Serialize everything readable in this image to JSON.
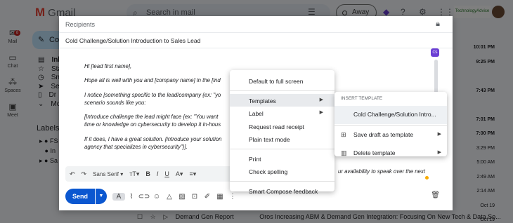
{
  "app": {
    "name": "Gmail",
    "search_placeholder": "Search in mail",
    "status": "Away",
    "brand_text": "TechnologyAdvice"
  },
  "rail": [
    {
      "icon": "mail-icon",
      "label": "Mail",
      "badge": "8"
    },
    {
      "icon": "chat-icon",
      "label": "Chat"
    },
    {
      "icon": "spaces-icon",
      "label": "Spaces"
    },
    {
      "icon": "meet-icon",
      "label": "Meet"
    }
  ],
  "sidebar": {
    "compose_label": "Co",
    "items": [
      "Inb",
      "Sta",
      "Sn",
      "Se",
      "Dr",
      "Mo"
    ],
    "labels_title": "Labels",
    "labels": [
      "FS",
      "In",
      "Sa"
    ]
  },
  "mail_times": [
    "10:01 PM",
    "9:25 PM",
    "",
    "7:43 PM",
    "",
    "7:01 PM",
    "7:00 PM",
    "3:29 PM",
    "5:00 AM",
    "2:49 AM",
    "2:14 AM",
    "Oct 19",
    "Oct 19"
  ],
  "bottom_row": {
    "sender": "Demand Gen Report",
    "subject": "Oros Increasing ABM & Demand Gen Integration: Focusing On New Tech & Data So..."
  },
  "compose": {
    "recipients_placeholder": "Recipients",
    "subject": "Cold Challenge/Solution Introduction to Sales Lead",
    "cs_badge": "CS",
    "body": [
      "Hi [lead first name],",
      "Hope all is well with you and [company name] in the [ind",
      "I notice [something specific to the lead/company {ex: \"yo",
      "scenario sounds like you:",
      "[Introduce challenge the lead might face {ex: \"You want",
      "time or knowledge on cybersecurity to develop it in-hous",
      "If it does, I have a great solution. [introduce your solution",
      "agency that specializes in cybersecurity\"}]."
    ],
    "body_right": "ur availability to speak over the next",
    "format_bar": {
      "font": "Sans Serif",
      "undo": "↶",
      "redo": "↷"
    },
    "send_label": "Send"
  },
  "context_menu": {
    "items": [
      {
        "label": "Default to full screen",
        "arrow": false
      },
      {
        "label": "Templates",
        "arrow": true,
        "highlight": true
      },
      {
        "label": "Label",
        "arrow": true
      },
      {
        "label": "Request read receipt",
        "arrow": false
      },
      {
        "label": "Plain text mode",
        "arrow": false
      },
      {
        "label": "Print",
        "arrow": false
      },
      {
        "label": "Check spelling",
        "arrow": false
      },
      {
        "label": "Smart Compose feedback",
        "arrow": false
      }
    ]
  },
  "templates_menu": {
    "header": "INSERT TEMPLATE",
    "template_name": "Cold Challenge/Solution Intro...",
    "save_label": "Save draft as template",
    "delete_label": "Delete template"
  }
}
